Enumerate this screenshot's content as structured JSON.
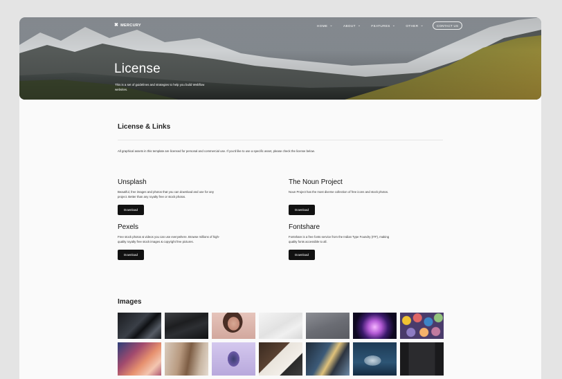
{
  "brand": {
    "name": "MERCURY",
    "logo_icon": "asterisk-icon"
  },
  "nav": {
    "items": [
      {
        "label": "HOME"
      },
      {
        "label": "ABOUT"
      },
      {
        "label": "FEATURES"
      },
      {
        "label": "OTHER"
      }
    ],
    "contact_label": "CONTACT US"
  },
  "hero": {
    "title": "License",
    "subtitle": "This is a set of guidelines and strategies to help you build Webflow websites."
  },
  "license": {
    "title": "License & Links",
    "intro": "All graphical assets in this template are licensed for personal and commercial use. If you'd like to use a specific asset, please check the license below."
  },
  "resources": [
    {
      "name": "Unsplash",
      "desc": "Beautiful, free images and photos that you can download and use for any project. Better than any royalty free or stock photos.",
      "button": "Download"
    },
    {
      "name": "The Noun Project",
      "desc": "Noun Project has the most diverse collection of free icons and stock photos.",
      "button": "Download"
    },
    {
      "name": "Pexels",
      "desc": "Free stock photos & videos you can use everywhere. Browse millions of high-quality royalty free stock images & copyright free pictures.",
      "button": "Download"
    },
    {
      "name": "Fontshare",
      "desc": "Fontshare is a free fonts service from the Indian Type Foundry (ITF), making quality fonts accessible to all.",
      "button": "Download"
    }
  ],
  "images": {
    "title": "Images",
    "thumbs": [
      "dark-silk-fabric",
      "black-cloth-folds",
      "woman-portrait",
      "white-paper-texture",
      "grey-gradient",
      "glass-sphere-neon",
      "colorful-balls",
      "pink-abstract-waves",
      "woman-long-hair",
      "mannequin-head-art",
      "notebook-pen",
      "phone-apps",
      "ocean-wave",
      "dark-phone-screen"
    ]
  },
  "colors": {
    "accent": "#111111",
    "page_bg": "#fafafa",
    "outer_bg": "#e4e4e4"
  }
}
